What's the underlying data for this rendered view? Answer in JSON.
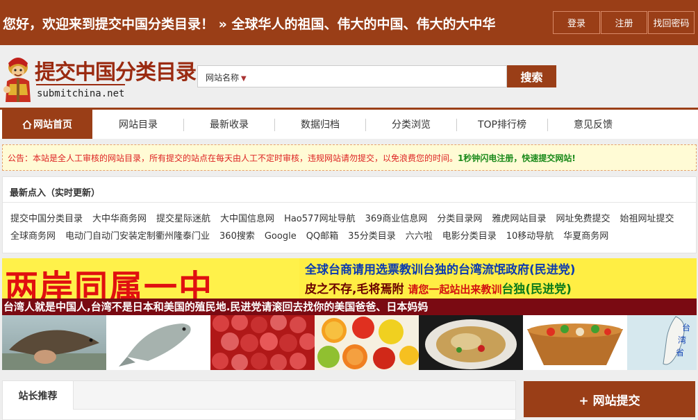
{
  "topbar": {
    "welcome": "您好，欢迎来到提交中国分类目录！ » 全球华人的祖国、伟大的中国、伟大的大中华",
    "login": "登录",
    "register": "注册",
    "recover_password": "找回密码"
  },
  "logo": {
    "title": "提交中国分类目录",
    "url": "submitchina.net"
  },
  "search": {
    "type": "网站名称",
    "button": "搜索"
  },
  "nav": {
    "items": [
      {
        "label": "网站首页"
      },
      {
        "label": "网站目录"
      },
      {
        "label": "最新收录"
      },
      {
        "label": "数据归档"
      },
      {
        "label": "分类浏览"
      },
      {
        "label": "TOP排行榜"
      },
      {
        "label": "意见反馈"
      }
    ]
  },
  "notice": {
    "text": "公告：本站是全人工审核的网站目录，所有提交的站点在每天由人工不定时审核，违规网站请勿提交，以免浪费您的时间。",
    "highlight": "1秒钟闪电注册，快速提交网站!"
  },
  "latest": {
    "title": "最新点入（实时更新）",
    "row1": [
      "提交中国分类目录",
      "大中华商务网",
      "提交星际迷航",
      "大中国信息网",
      "Hao577网址导航",
      "369商业信息网",
      "分类目录网",
      "雅虎网站目录",
      "网址免费提交",
      "始祖网址提交"
    ],
    "row2": [
      "全球商务网",
      "电动门自动门安装定制衢州隆泰门业",
      "360搜索",
      "Google",
      "QQ邮箱",
      "35分类目录",
      "六六啦",
      "电影分类目录",
      "10移动导航",
      "华夏商务网"
    ]
  },
  "banner": {
    "big": "两岸同属一中",
    "line1": "全球台商请用选票教训台独的台湾流氓政府(民进党)",
    "line2_a": "皮之不存,毛将焉附",
    "line2_b": "请您一起站出来教训",
    "line2_c": "台独(民进党)",
    "strip": "台湾人就是中国人,台湾不是日本和美国的殖民地.民进党请滚回去找你的美国爸爸、日本妈妈",
    "map_label": "台湾省"
  },
  "recommend": {
    "tab": "站长推荐"
  },
  "submit": {
    "label": "+ 网站提交"
  },
  "colors": {
    "brand": "#9a3e17",
    "notice_bg": "#fffbd5",
    "banner_yellow": "#ffee44",
    "banner_red": "#e01010",
    "strip": "#7a0a12"
  }
}
